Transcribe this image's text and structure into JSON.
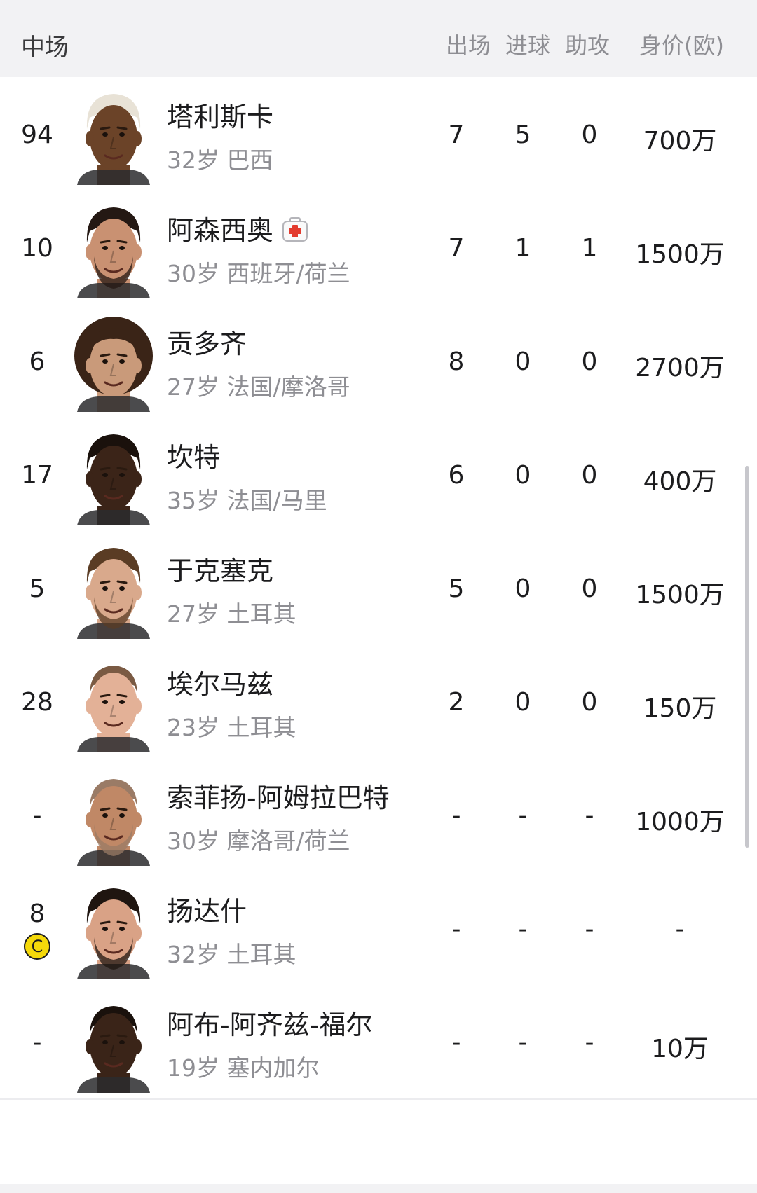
{
  "header": {
    "section": "中场",
    "cols": [
      "出场",
      "进球",
      "助攻",
      "身价(欧)"
    ]
  },
  "players": [
    {
      "num": "94",
      "name": "塔利斯卡",
      "sub": "32岁 巴西",
      "apps": "7",
      "goals": "5",
      "assists": "0",
      "value": "700万",
      "skin": "#6b4328",
      "hair": "#e8e2d6",
      "hair_style": "short",
      "beard": false,
      "injured": false,
      "captain": false
    },
    {
      "num": "10",
      "name": "阿森西奥",
      "sub": "30岁 西班牙/荷兰",
      "apps": "7",
      "goals": "1",
      "assists": "1",
      "value": "1500万",
      "skin": "#c99172",
      "hair": "#241813",
      "hair_style": "short",
      "beard": true,
      "injured": true,
      "captain": false
    },
    {
      "num": "6",
      "name": "贡多齐",
      "sub": "27岁 法国/摩洛哥",
      "apps": "8",
      "goals": "0",
      "assists": "0",
      "value": "2700万",
      "skin": "#c99a7a",
      "hair": "#3a2417",
      "hair_style": "curly",
      "beard": false,
      "injured": false,
      "captain": false
    },
    {
      "num": "17",
      "name": "坎特",
      "sub": "35岁 法国/马里",
      "apps": "6",
      "goals": "0",
      "assists": "0",
      "value": "400万",
      "skin": "#3b2418",
      "hair": "#1a110c",
      "hair_style": "short",
      "beard": false,
      "injured": false,
      "captain": false
    },
    {
      "num": "5",
      "name": "于克塞克",
      "sub": "27岁 土耳其",
      "apps": "5",
      "goals": "0",
      "assists": "0",
      "value": "1500万",
      "skin": "#d9a98c",
      "hair": "#5a3c24",
      "hair_style": "short",
      "beard": true,
      "injured": false,
      "captain": false
    },
    {
      "num": "28",
      "name": "埃尔马兹",
      "sub": "23岁 土耳其",
      "apps": "2",
      "goals": "0",
      "assists": "0",
      "value": "150万",
      "skin": "#e3b197",
      "hair": "#7a5a43",
      "hair_style": "buzz",
      "beard": false,
      "injured": false,
      "captain": false
    },
    {
      "num": "-",
      "name": "索菲扬-阿姆拉巴特",
      "sub": "30岁 摩洛哥/荷兰",
      "apps": "-",
      "goals": "-",
      "assists": "-",
      "value": "1000万",
      "skin": "#c08866",
      "hair": "#9a7b66",
      "hair_style": "buzz",
      "beard": true,
      "injured": false,
      "captain": false
    },
    {
      "num": "8",
      "name": "扬达什",
      "sub": "32岁 土耳其",
      "apps": "-",
      "goals": "-",
      "assists": "-",
      "value": "-",
      "skin": "#d9a286",
      "hair": "#1f1510",
      "hair_style": "short",
      "beard": true,
      "injured": false,
      "captain": true,
      "captain_mark": "C"
    },
    {
      "num": "-",
      "name": "阿布-阿齐兹-福尔",
      "sub": "19岁 塞内加尔",
      "apps": "-",
      "goals": "-",
      "assists": "-",
      "value": "10万",
      "skin": "#3a2418",
      "hair": "#1a110c",
      "hair_style": "buzz",
      "beard": false,
      "injured": false,
      "captain": false
    }
  ],
  "colors": {
    "medical_red": "#e33b2e",
    "captain_yellow": "#f5d90a",
    "muted": "#8e8e93"
  }
}
